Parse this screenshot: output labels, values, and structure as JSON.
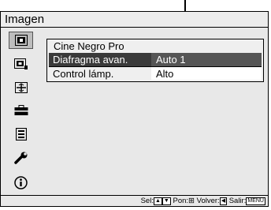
{
  "menu": {
    "title": "Imagen"
  },
  "sidebar": {
    "items": [
      {
        "icon": "picture-icon",
        "active": true
      },
      {
        "icon": "picture-advanced-icon",
        "active": false
      },
      {
        "icon": "screen-icon",
        "active": false
      },
      {
        "icon": "setup-briefcase-icon",
        "active": false
      },
      {
        "icon": "menu-list-icon",
        "active": false
      },
      {
        "icon": "wrench-icon",
        "active": false
      },
      {
        "icon": "information-icon",
        "active": false
      }
    ]
  },
  "panel": {
    "header": "Cine Negro Pro",
    "rows": [
      {
        "label": "Diafragma avan.",
        "value": "Auto 1",
        "selected": true
      },
      {
        "label": "Control lámp.",
        "value": "Alto",
        "selected": false
      }
    ]
  },
  "footer": {
    "sel_label": "Sel:",
    "pon_label": "Pon:",
    "volver_label": "Volver:",
    "salir_label": "Salir:",
    "menu_key": "MENU"
  },
  "colors": {
    "background": "#e8e8e8",
    "selected_row": "#3a3a3a",
    "active_icon_bg": "#bdbdbd"
  }
}
